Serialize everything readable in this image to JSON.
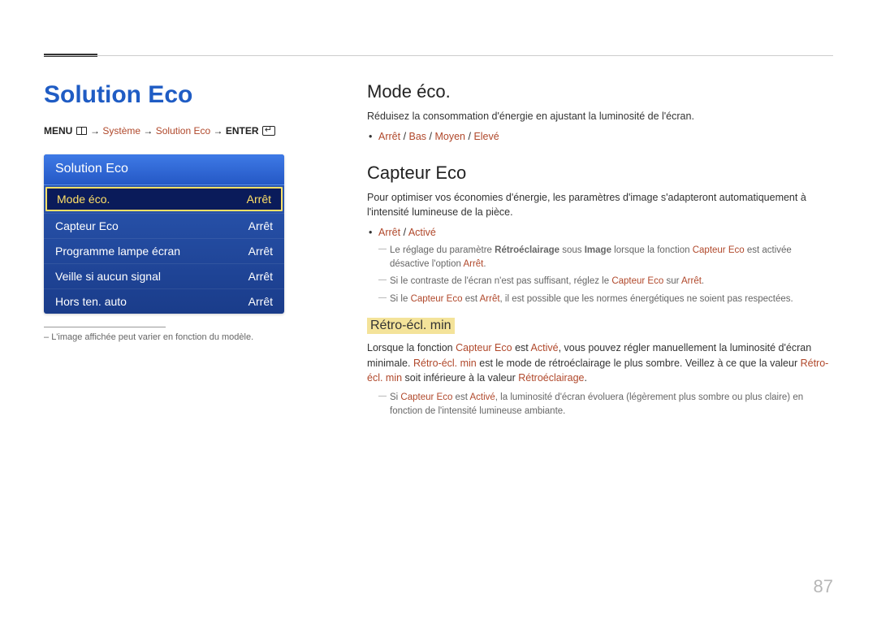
{
  "page_number": "87",
  "left": {
    "title": "Solution Eco",
    "breadcrumb": {
      "menu": "MENU",
      "systeme": "Système",
      "solution_eco": "Solution Eco",
      "enter": "ENTER"
    },
    "menu": {
      "header": "Solution Eco",
      "items": [
        {
          "label": "Mode éco.",
          "value": "Arrêt",
          "selected": true
        },
        {
          "label": "Capteur Eco",
          "value": "Arrêt",
          "selected": false
        },
        {
          "label": "Programme lampe écran",
          "value": "Arrêt",
          "selected": false
        },
        {
          "label": "Veille si aucun signal",
          "value": "Arrêt",
          "selected": false
        },
        {
          "label": "Hors ten. auto",
          "value": "Arrêt",
          "selected": false
        }
      ]
    },
    "note": "L'image affichée peut varier en fonction du modèle."
  },
  "right": {
    "mode_eco_h": "Mode éco.",
    "mode_eco_p": "Réduisez la consommation d'énergie en ajustant la luminosité de l'écran.",
    "mode_eco_opts": {
      "a": "Arrêt",
      "b": "Bas",
      "c": "Moyen",
      "d": "Elevé"
    },
    "capteur_h": "Capteur Eco",
    "capteur_p": "Pour optimiser vos économies d'énergie, les paramètres d'image s'adapteront automatiquement à l'intensité lumineuse de la pièce.",
    "capteur_opts": {
      "a": "Arrêt",
      "b": "Activé"
    },
    "capteur_n1_pre": "Le réglage du paramètre ",
    "capteur_n1_b1": "Rétroéclairage",
    "capteur_n1_mid": " sous ",
    "capteur_n1_b2": "Image",
    "capteur_n1_mid2": " lorsque la fonction ",
    "capteur_n1_hl": "Capteur Eco",
    "capteur_n1_mid3": " est activée désactive l'option ",
    "capteur_n1_hl2": "Arrêt",
    "capteur_n1_end": ".",
    "capteur_n2_pre": "Si le contraste de l'écran n'est pas suffisant, réglez le ",
    "capteur_n2_hl": "Capteur Eco",
    "capteur_n2_mid": " sur ",
    "capteur_n2_hl2": "Arrêt",
    "capteur_n2_end": ".",
    "capteur_n3_pre": "Si le ",
    "capteur_n3_hl": "Capteur Eco",
    "capteur_n3_mid": " est ",
    "capteur_n3_hl2": "Arrêt",
    "capteur_n3_end": ", il est possible que les normes énergétiques ne soient pas respectées.",
    "retro_h": "Rétro-écl. min",
    "retro_p1_pre": "Lorsque la fonction ",
    "retro_p1_hl1": "Capteur Eco",
    "retro_p1_mid1": " est ",
    "retro_p1_hl2": "Activé",
    "retro_p1_mid2": ", vous pouvez régler manuellement la luminosité d'écran minimale. ",
    "retro_p1_hl3": "Rétro-écl. min",
    "retro_p1_mid3": " est le mode de rétroéclairage le plus sombre. Veillez à ce que la valeur ",
    "retro_p1_hl4": "Rétro-écl. min",
    "retro_p1_mid4": " soit inférieure à la valeur ",
    "retro_p1_hl5": "Rétroéclairage",
    "retro_p1_end": ".",
    "retro_n1_pre": "Si ",
    "retro_n1_hl1": "Capteur Eco",
    "retro_n1_mid1": " est ",
    "retro_n1_hl2": "Activé",
    "retro_n1_end": ", la luminosité d'écran évoluera (légèrement plus sombre ou plus claire) en fonction de l'intensité lumineuse ambiante."
  }
}
